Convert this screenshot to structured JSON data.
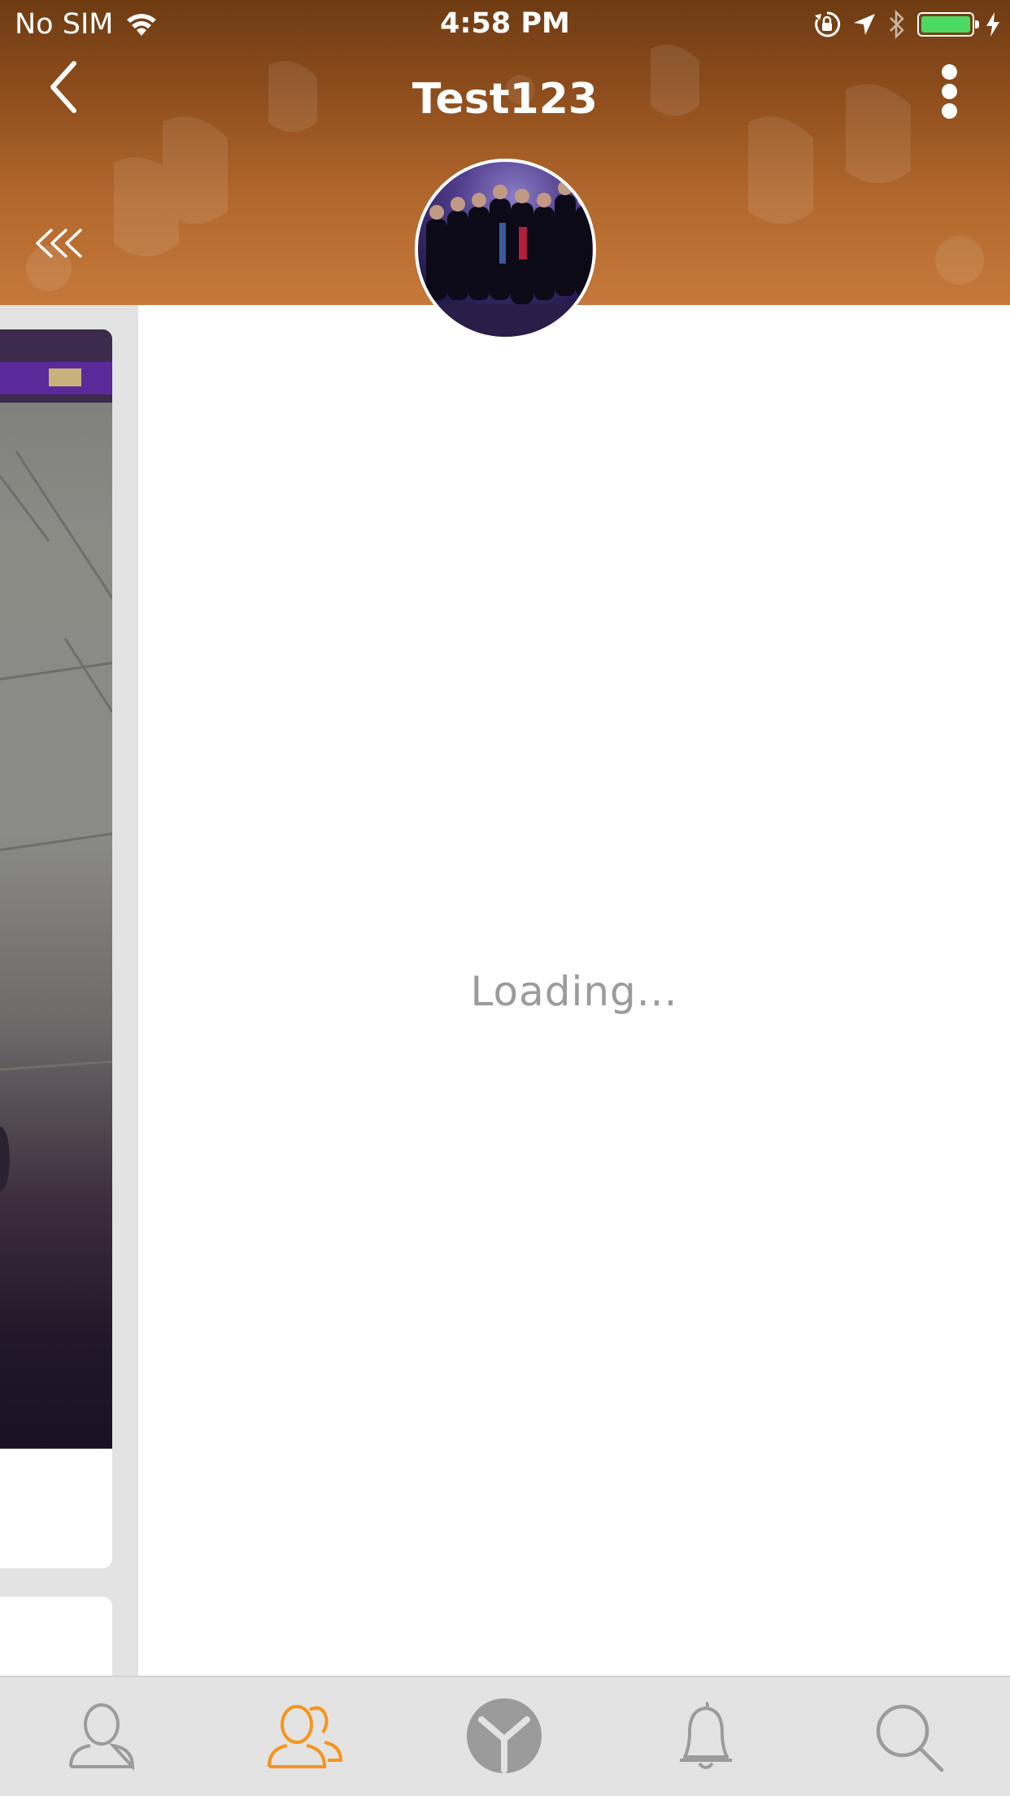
{
  "status_bar": {
    "carrier": "No SIM",
    "time": "4:58 PM",
    "battery_level": 1.0
  },
  "header": {
    "title": "Test123",
    "back_icon": "chevron-left-icon",
    "more_icon": "more-vertical-icon",
    "collapse_icon": "double-chevron-left-icon",
    "avatar": "group-photo-avatar"
  },
  "content": {
    "loading_text": "Loading..."
  },
  "tab_bar": {
    "active_color": "#f7941d",
    "inactive_color": "#9b9b9b",
    "tabs": [
      {
        "icon": "profile-icon",
        "active": false
      },
      {
        "icon": "friends-icon",
        "active": true
      },
      {
        "icon": "logo-icon",
        "active": false
      },
      {
        "icon": "bell-icon",
        "active": false
      },
      {
        "icon": "search-icon",
        "active": false
      }
    ]
  },
  "colors": {
    "header_top": "#6e3b12",
    "header_bottom": "#c5783a",
    "battery": "#4cd964"
  }
}
